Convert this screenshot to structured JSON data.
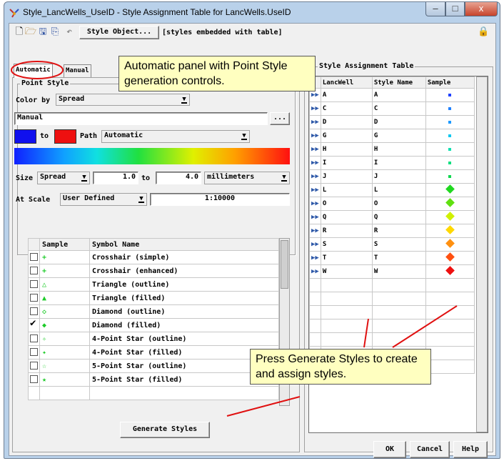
{
  "window": {
    "title": "Style_LancWells_UseID - Style Assignment Table for LancWells.UseID",
    "controls": {
      "minimize": "–",
      "maximize": "□",
      "close": "x"
    }
  },
  "toolbar": {
    "style_object_button": "Style Object...",
    "style_object_value": "[styles embedded with table]"
  },
  "tabs": [
    {
      "label": "Automatic",
      "active": true
    },
    {
      "label": "Manual",
      "active": false
    }
  ],
  "point_style": {
    "group_label": "Point Style",
    "color_by_label": "Color by",
    "color_by_value": "Spread",
    "palette_value": "Manual",
    "palette_browse": "...",
    "from_color": "#1010ee",
    "to_label": "to",
    "to_color": "#ee1010",
    "path_label": "Path",
    "path_value": "Automatic",
    "size_label": "Size",
    "size_mode": "Spread",
    "size_min": "1.0",
    "size_to_label": "to",
    "size_max": "4.0",
    "size_units": "millimeters",
    "at_scale_label": "At Scale",
    "at_scale_mode": "User Defined",
    "at_scale_value": "1:10000"
  },
  "symbol_table": {
    "headers": [
      "Sample",
      "Symbol Name"
    ],
    "rows": [
      {
        "name": "Crosshair (simple)",
        "icon": "crosshair-simple-icon",
        "glyph": "+",
        "checked": false
      },
      {
        "name": "Crosshair (enhanced)",
        "icon": "crosshair-enhanced-icon",
        "glyph": "+",
        "checked": false
      },
      {
        "name": "Triangle (outline)",
        "icon": "triangle-outline-icon",
        "glyph": "△",
        "checked": false
      },
      {
        "name": "Triangle (filled)",
        "icon": "triangle-filled-icon",
        "glyph": "▲",
        "checked": false
      },
      {
        "name": "Diamond (outline)",
        "icon": "diamond-outline-icon",
        "glyph": "◇",
        "checked": false
      },
      {
        "name": "Diamond (filled)",
        "icon": "diamond-filled-icon",
        "glyph": "◆",
        "checked": true
      },
      {
        "name": "4-Point Star (outline)",
        "icon": "four-point-star-outline-icon",
        "glyph": "✧",
        "checked": false
      },
      {
        "name": "4-Point Star (filled)",
        "icon": "four-point-star-filled-icon",
        "glyph": "✦",
        "checked": false
      },
      {
        "name": "5-Point Star (outline)",
        "icon": "five-point-star-outline-icon",
        "glyph": "☆",
        "checked": false
      },
      {
        "name": "5-Point Star (filled)",
        "icon": "five-point-star-filled-icon",
        "glyph": "★",
        "checked": false
      }
    ]
  },
  "generate_button": "Generate Styles",
  "assignment_table": {
    "group_label": "Style Assignment Table",
    "headers": [
      "LancWell",
      "Style Name",
      "Sample"
    ],
    "rows": [
      {
        "well": "A",
        "style": "A",
        "color": "#1e40ff",
        "shape": "dot"
      },
      {
        "well": "C",
        "style": "C",
        "color": "#1e80ff",
        "shape": "dot"
      },
      {
        "well": "D",
        "style": "D",
        "color": "#1e9aff",
        "shape": "dot"
      },
      {
        "well": "G",
        "style": "G",
        "color": "#10c8f0",
        "shape": "dot"
      },
      {
        "well": "H",
        "style": "H",
        "color": "#10e0b0",
        "shape": "dot"
      },
      {
        "well": "I",
        "style": "I",
        "color": "#10e080",
        "shape": "dot"
      },
      {
        "well": "J",
        "style": "J",
        "color": "#10d850",
        "shape": "dot"
      },
      {
        "well": "L",
        "style": "L",
        "color": "#20d820",
        "shape": "diamond"
      },
      {
        "well": "O",
        "style": "O",
        "color": "#60e010",
        "shape": "diamond"
      },
      {
        "well": "Q",
        "style": "Q",
        "color": "#d0f000",
        "shape": "diamond"
      },
      {
        "well": "R",
        "style": "R",
        "color": "#ffd800",
        "shape": "diamond"
      },
      {
        "well": "S",
        "style": "S",
        "color": "#ff9010",
        "shape": "diamond"
      },
      {
        "well": "T",
        "style": "T",
        "color": "#ff5010",
        "shape": "diamond"
      },
      {
        "well": "W",
        "style": "W",
        "color": "#ee1010",
        "shape": "diamond"
      }
    ]
  },
  "buttons": {
    "ok": "OK",
    "cancel": "Cancel",
    "help": "Help"
  },
  "callouts": {
    "top": "Automatic panel with Point Style generation controls.",
    "bottom": "Press Generate Styles to create and assign styles."
  },
  "annotation_color": "#e01010"
}
